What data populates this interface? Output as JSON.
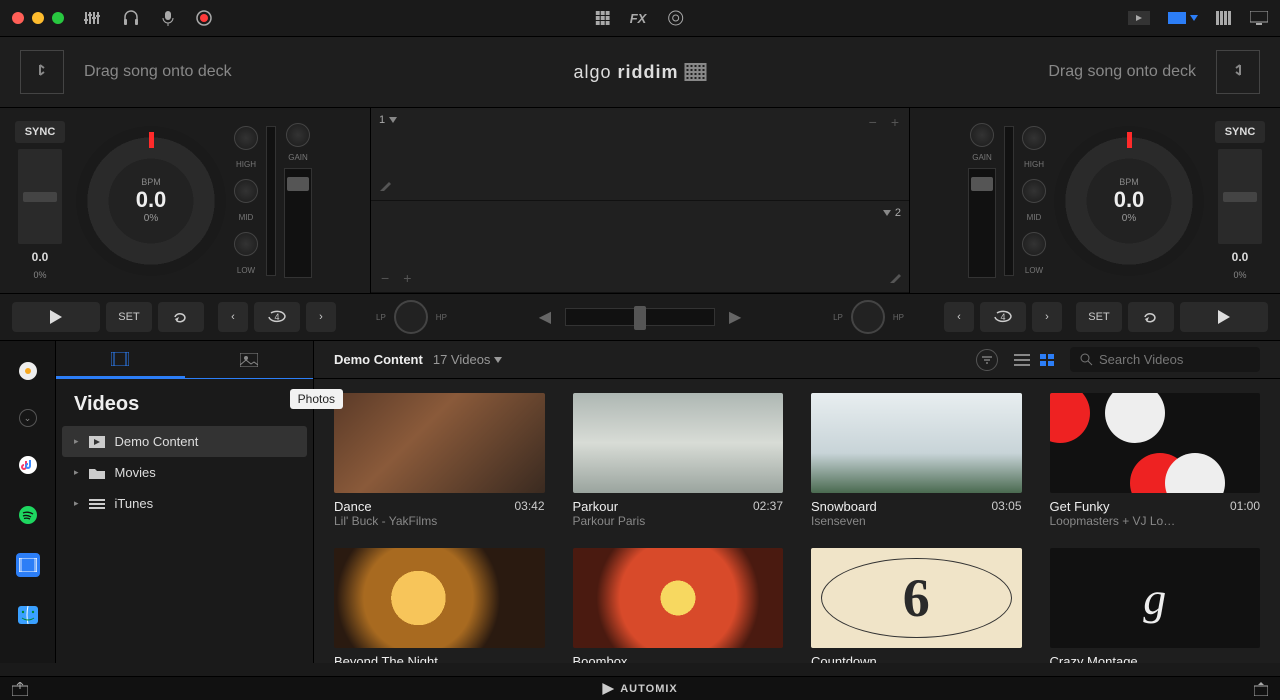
{
  "titlebar": {
    "traffic": [
      "#ff5f57",
      "#febc2e",
      "#28c840"
    ],
    "center_fx": "FX"
  },
  "deck_header": {
    "left_hint": "Drag song onto deck",
    "right_hint": "Drag song onto deck",
    "logo_a": "algo",
    "logo_b": "riddim"
  },
  "deck_left": {
    "sync": "SYNC",
    "bpm_label": "BPM",
    "bpm": "0.0",
    "pct": "0%",
    "pitch_bpm": "0.0",
    "pitch_pct": "0%",
    "tick_color": "#ff2a2a",
    "eq": [
      "HIGH",
      "MID",
      "LOW"
    ],
    "gain": "GAIN"
  },
  "deck_right": {
    "sync": "SYNC",
    "bpm_label": "BPM",
    "bpm": "0.0",
    "pct": "0%",
    "pitch_bpm": "0.0",
    "pitch_pct": "0%",
    "tick_color": "#ff2a2a",
    "eq": [
      "HIGH",
      "MID",
      "LOW"
    ],
    "gain": "GAIN"
  },
  "waveform": {
    "track1": "1",
    "track2": "2"
  },
  "transport": {
    "set": "SET",
    "loop": "4",
    "lp": "LP",
    "hp": "HP"
  },
  "browser": {
    "tooltip": "Photos",
    "section_title": "Videos",
    "items": [
      {
        "label": "Demo Content",
        "icon": "play-folder",
        "sel": true
      },
      {
        "label": "Movies",
        "icon": "folder",
        "sel": false
      },
      {
        "label": "iTunes",
        "icon": "list",
        "sel": false
      }
    ],
    "header_title": "Demo Content",
    "header_count": "17 Videos",
    "search_placeholder": "Search Videos"
  },
  "videos": [
    {
      "title": "Dance",
      "artist": "Lil' Buck - YakFilms",
      "time": "03:42",
      "thumb": "th1"
    },
    {
      "title": "Parkour",
      "artist": "Parkour Paris",
      "time": "02:37",
      "thumb": "th2"
    },
    {
      "title": "Snowboard",
      "artist": "Isenseven",
      "time": "03:05",
      "thumb": "th3"
    },
    {
      "title": "Get Funky",
      "artist": "Loopmasters + VJ Lo…",
      "time": "01:00",
      "thumb": "th4"
    },
    {
      "title": "Beyond The Night",
      "artist": "",
      "time": "",
      "thumb": "th5"
    },
    {
      "title": "Boombox",
      "artist": "",
      "time": "",
      "thumb": "th6"
    },
    {
      "title": "Countdown",
      "artist": "",
      "time": "",
      "thumb": "th7"
    },
    {
      "title": "Crazy Montage",
      "artist": "",
      "time": "",
      "thumb": "th8"
    }
  ],
  "bottombar": {
    "automix": "AUTOMIX"
  }
}
